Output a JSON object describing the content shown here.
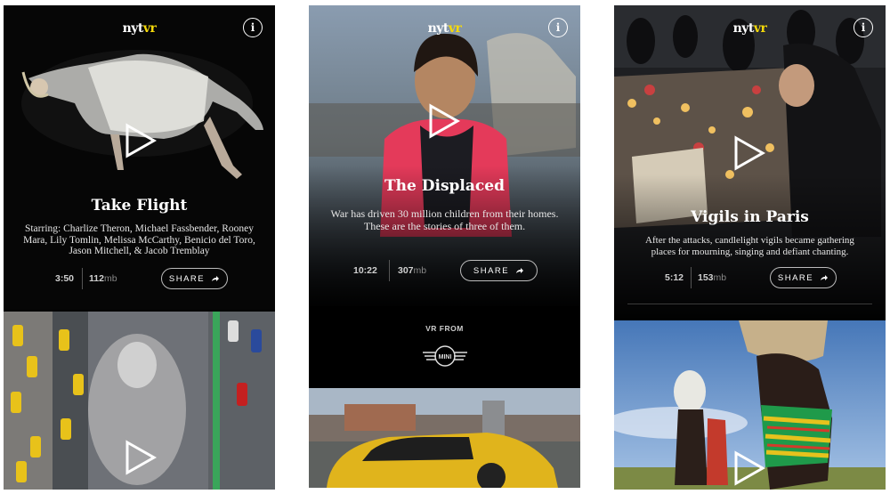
{
  "cards": [
    {
      "logo": {
        "nyt": "nyt",
        "vr": "vr"
      },
      "info_label": "i",
      "title": "Take Flight",
      "description": "Starring: Charlize Theron, Michael Fassbender, Rooney Mara, Lily Tomlin, Melissa McCarthy, Benicio del Toro, Jason Mitchell, & Jacob Tremblay",
      "duration": "3:50",
      "size": "112",
      "size_unit": "mb",
      "share_label": "SHARE"
    },
    {
      "logo": {
        "nyt": "nyt",
        "vr": "vr"
      },
      "info_label": "i",
      "title": "The Displaced",
      "description": "War has driven 30 million children from their homes. These are the stories of three of them.",
      "duration": "10:22",
      "size": "307",
      "size_unit": "mb",
      "share_label": "SHARE",
      "sponsor": {
        "label": "VR FROM",
        "brand": "MINI"
      }
    },
    {
      "logo": {
        "nyt": "nyt",
        "vr": "vr"
      },
      "info_label": "i",
      "title": "Vigils in Paris",
      "description": "After the attacks, candlelight vigils became gathering places for mourning, singing and defiant chanting.",
      "duration": "5:12",
      "size": "153",
      "size_unit": "mb",
      "share_label": "SHARE"
    }
  ],
  "colors": {
    "brand_vr": "#f5d90a",
    "background": "#000000"
  }
}
